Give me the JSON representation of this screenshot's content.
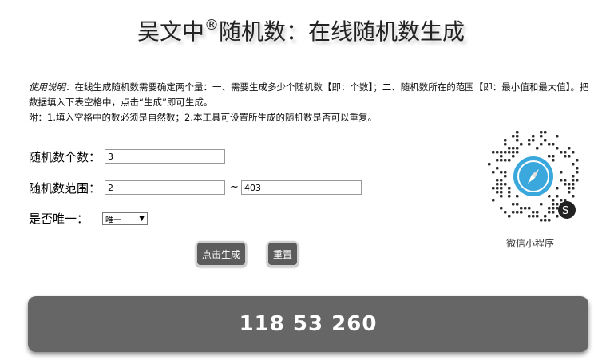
{
  "header": {
    "title_prefix": "吴文中",
    "title_mark": "®",
    "title_suffix": "随机数：在线随机数生成"
  },
  "instructions": {
    "label": "使用说明：",
    "line1": "在线生成随机数需要确定两个量：一、需要生成多少个随机数【即：个数】；二、随机数所在的范围【即：最小值和最大值】。把数据填入下表空格中，点击“生成”即可生成。",
    "line2": "附：1.填入空格中的数必须是自然数；2.本工具可设置所生成的随机数是否可以重复。"
  },
  "form": {
    "count_label": "随机数个数：",
    "count_value": "3",
    "range_label": "随机数范围：",
    "range_min": "2",
    "range_separator": "~",
    "range_max": "403",
    "unique_label": "是否唯一：",
    "unique_selected": "唯一",
    "generate_label": "点击生成",
    "reset_label": "重置"
  },
  "qr": {
    "caption": "微信小程序",
    "accent_color": "#3aa8dc"
  },
  "result": {
    "numbers": "118 53 260"
  }
}
